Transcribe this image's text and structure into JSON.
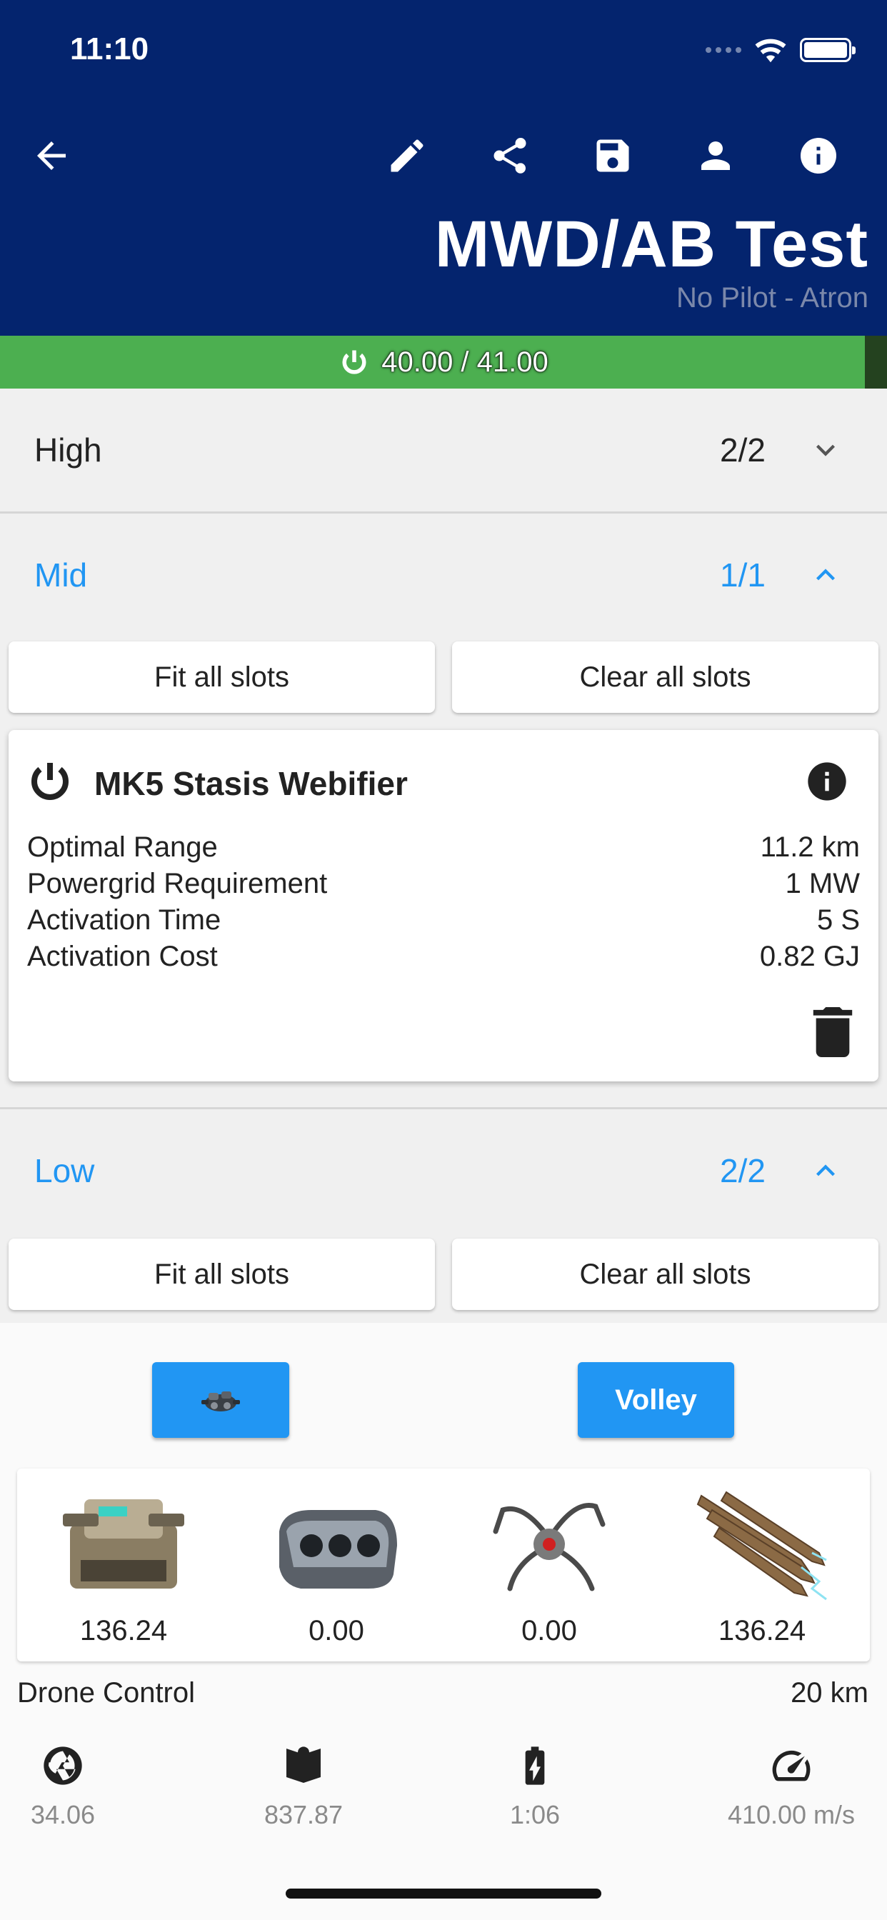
{
  "status": {
    "time": "11:10"
  },
  "header": {
    "title": "MWD/AB Test",
    "subtitle": "No Pilot - Atron",
    "icons": [
      "back-arrow-icon",
      "edit-icon",
      "share-icon",
      "save-icon",
      "person-icon",
      "info-icon"
    ]
  },
  "powergrid": {
    "label": "40.00 / 41.00",
    "used": 40.0,
    "total": 41.0,
    "fill_fraction": 0.975,
    "color": "#4caf50"
  },
  "slots": {
    "high": {
      "label": "High",
      "count": "2/2",
      "expanded": false
    },
    "mid": {
      "label": "Mid",
      "count": "1/1",
      "expanded": true,
      "fit_all": "Fit all slots",
      "clear_all": "Clear all slots",
      "module": {
        "name": "MK5 Stasis Webifier",
        "stats": [
          {
            "key": "Optimal Range",
            "value": "11.2 km"
          },
          {
            "key": "Powergrid Requirement",
            "value": "1 MW"
          },
          {
            "key": "Activation Time",
            "value": "5 S"
          },
          {
            "key": "Activation Cost",
            "value": "0.82 GJ"
          }
        ]
      }
    },
    "low": {
      "label": "Low",
      "count": "2/2",
      "expanded": true,
      "fit_all": "Fit all slots",
      "clear_all": "Clear all slots"
    }
  },
  "damage": {
    "mode_button": "Volley",
    "columns": [
      {
        "icon": "turret-icon",
        "value": "136.24"
      },
      {
        "icon": "missile-launcher-icon",
        "value": "0.00"
      },
      {
        "icon": "drone-icon",
        "value": "0.00"
      },
      {
        "icon": "missiles-icon",
        "value": "136.24"
      }
    ]
  },
  "drone_control": {
    "label": "Drone Control",
    "value": "20 km"
  },
  "summary": [
    {
      "icon": "aperture-icon",
      "value": "34.06"
    },
    {
      "icon": "book-icon",
      "value": "837.87"
    },
    {
      "icon": "battery-charging-icon",
      "value": "1:06"
    },
    {
      "icon": "speedometer-icon",
      "value": "410.00 m/s"
    }
  ],
  "colors": {
    "appbar": "#04246e",
    "accent": "#2196f3",
    "powergrid": "#4caf50"
  }
}
